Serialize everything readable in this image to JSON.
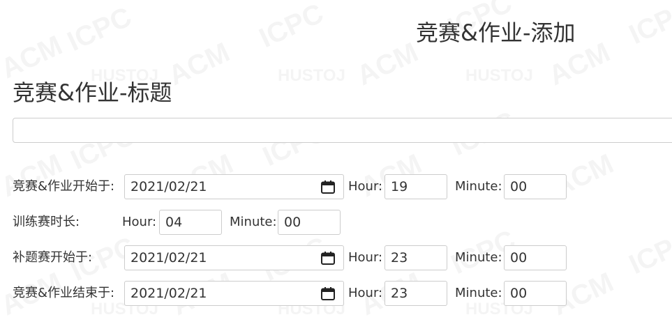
{
  "page": {
    "title": "竞赛&作业-添加"
  },
  "watermark": {
    "texts": [
      "ACM",
      "ICPC",
      "HUSTOJ"
    ]
  },
  "form": {
    "title_label": "竞赛&作业-标题",
    "title_value": "",
    "start": {
      "label": "竞赛&作业开始于:",
      "date": "2021/02/21",
      "hour_label": "Hour:",
      "hour": "19",
      "minute_label": "Minute:",
      "minute": "00"
    },
    "duration": {
      "label": "训练赛时长:",
      "hour_label": "Hour:",
      "hour": "04",
      "minute_label": "Minute:",
      "minute": "00"
    },
    "makeup": {
      "label": "补题赛开始于:",
      "date": "2021/02/21",
      "hour_label": "Hour:",
      "hour": "23",
      "minute_label": "Minute:",
      "minute": "00"
    },
    "end": {
      "label": "竞赛&作业结束于:",
      "date": "2021/02/21",
      "hour_label": "Hour:",
      "hour": "23",
      "minute_label": "Minute:",
      "minute": "00"
    }
  },
  "icons": {
    "calendar": "calendar-icon"
  }
}
